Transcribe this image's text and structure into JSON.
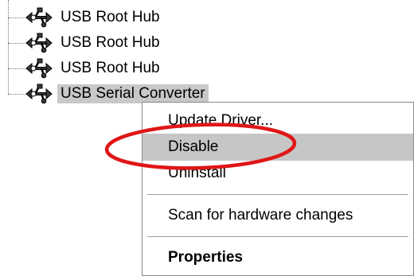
{
  "device_tree": {
    "items": [
      {
        "label": "USB Root Hub",
        "icon": "usb-icon",
        "selected": false
      },
      {
        "label": "USB Root Hub",
        "icon": "usb-icon",
        "selected": false
      },
      {
        "label": "USB Root Hub",
        "icon": "usb-icon",
        "selected": false
      },
      {
        "label": "USB Serial Converter",
        "icon": "usb-icon",
        "selected": true
      }
    ]
  },
  "context_menu": {
    "items": [
      {
        "label": "Update Driver...",
        "highlighted": false,
        "bold": false
      },
      {
        "label": "Disable",
        "highlighted": true,
        "bold": false
      },
      {
        "label": "Uninstall",
        "highlighted": false,
        "bold": false
      },
      {
        "label": "Scan for hardware changes",
        "highlighted": false,
        "bold": false
      },
      {
        "label": "Properties",
        "highlighted": false,
        "bold": true
      }
    ]
  },
  "colors": {
    "selection": "#c8c8c8",
    "menu_highlight": "#c6c6c6",
    "annotation": "#e01616"
  }
}
